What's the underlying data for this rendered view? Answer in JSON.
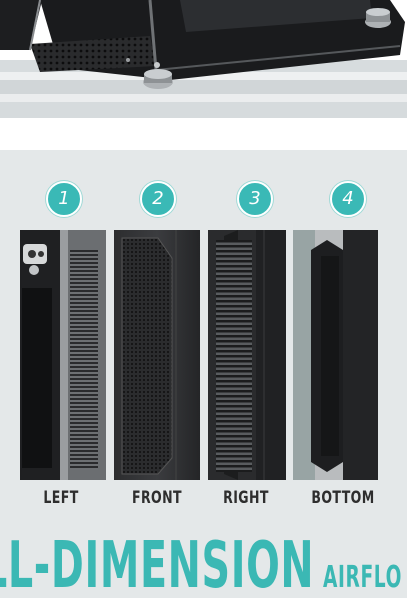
{
  "top_image": {
    "subject": "case-bottom-photo"
  },
  "views": [
    {
      "number": "1",
      "label": "LEFT"
    },
    {
      "number": "2",
      "label": "FRONT"
    },
    {
      "number": "3",
      "label": "RIGHT"
    },
    {
      "number": "4",
      "label": "BOTTOM"
    }
  ],
  "headline": {
    "main": "LL-DIMENSION",
    "trail": "AIRFLO"
  },
  "colors": {
    "accent": "#3ab9b6",
    "panel_bg": "#e4e8e9",
    "label": "#2e2e2e",
    "case_dark": "#1c1c1e"
  }
}
